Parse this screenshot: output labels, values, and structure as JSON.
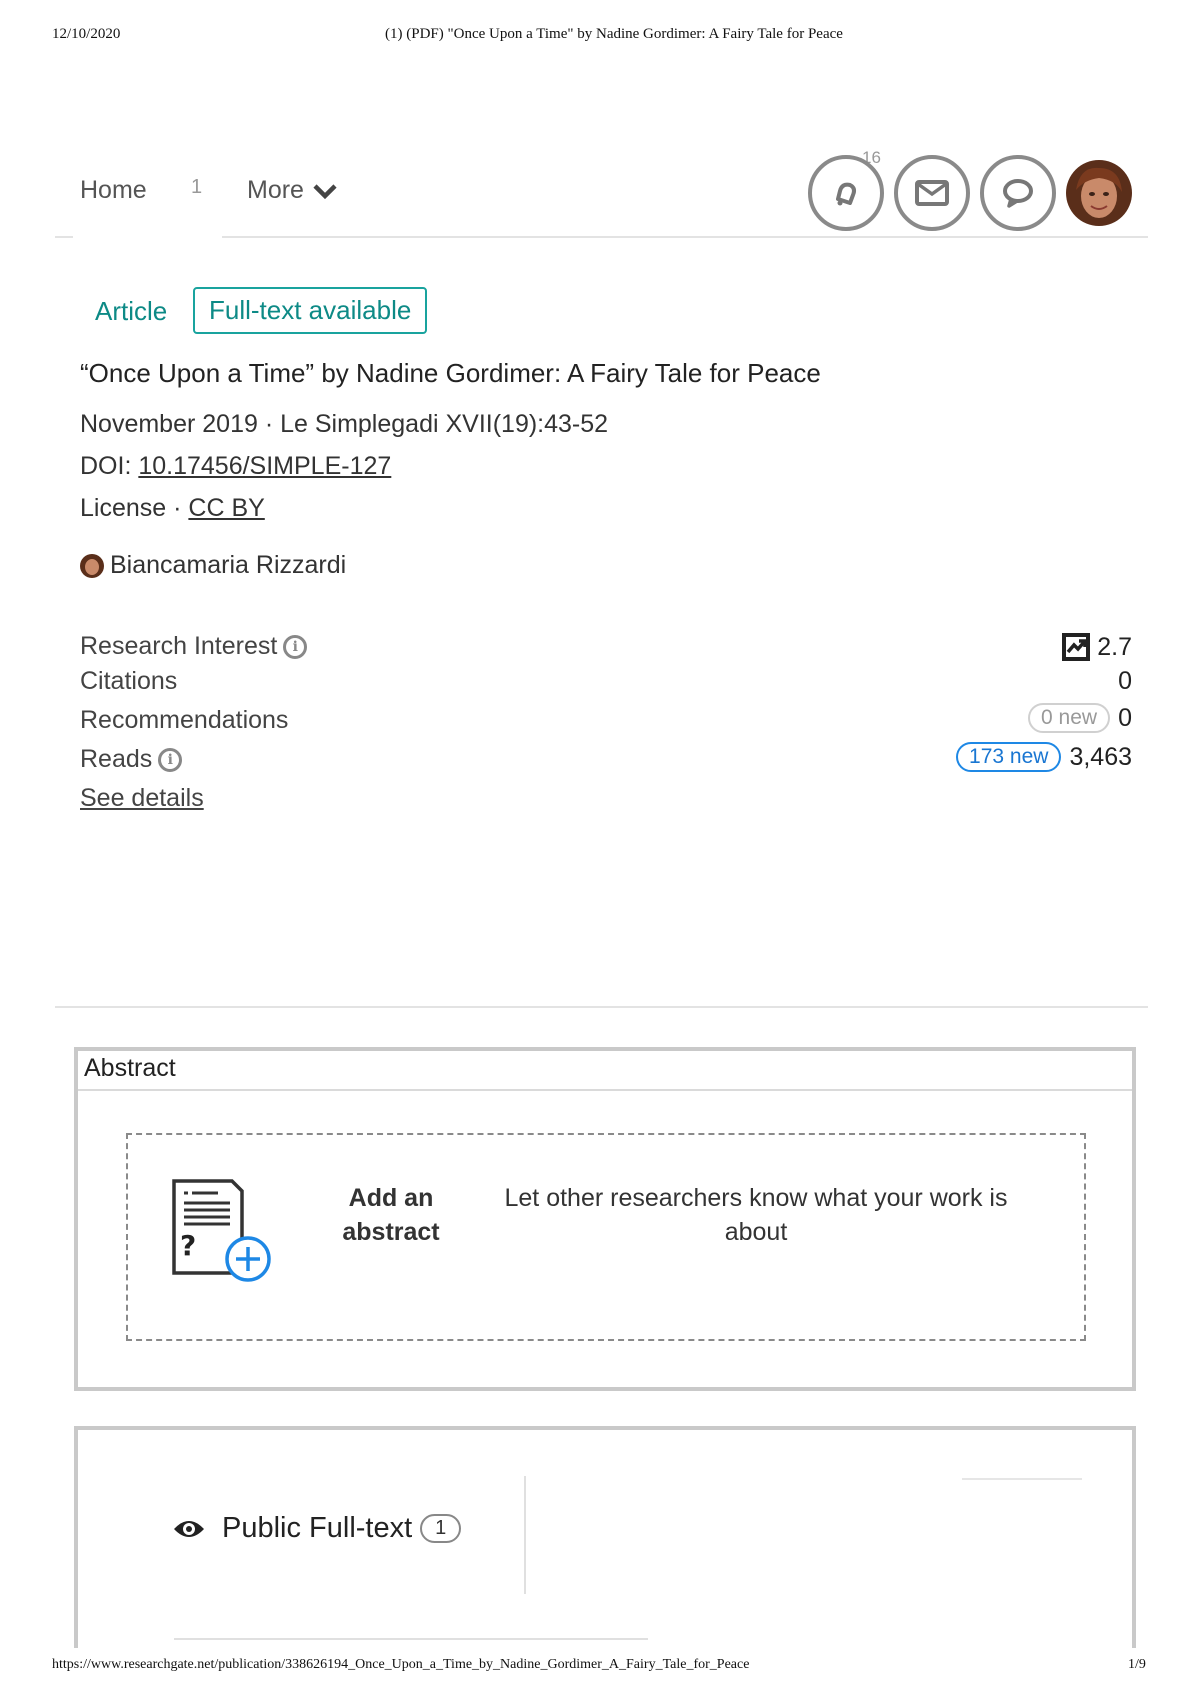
{
  "print_header": {
    "date": "12/10/2020",
    "doc_title": "(1) (PDF) \"Once Upon a Time\" by Nadine Gordimer: A Fairy Tale for Peace"
  },
  "nav": {
    "home_label": "Home",
    "home_count": "1",
    "more_label": "More",
    "notifications_count": "16"
  },
  "tags": {
    "type": "Article",
    "availability": "Full-text available"
  },
  "publication": {
    "title": "“Once Upon a Time” by Nadine Gordimer: A Fairy Tale for Peace",
    "date_journal": "November 2019 · Le Simplegadi XVII(19):43-52",
    "doi_label": "DOI: ",
    "doi": "10.17456/SIMPLE-127",
    "license_label": "License · ",
    "license": "CC BY",
    "author": "Biancamaria Rizzardi"
  },
  "stats": {
    "research_interest_label": "Research Interest",
    "research_interest_value": "2.7",
    "citations_label": "Citations",
    "citations_value": "0",
    "recommendations_label": "Recommendations",
    "recommendations_new": "0 new",
    "recommendations_value": "0",
    "reads_label": "Reads",
    "reads_new": "173 new",
    "reads_value": "3,463",
    "see_details": "See details"
  },
  "abstract": {
    "heading": "Abstract",
    "add_label": "Add an abstract",
    "hint": "Let other researchers know what your work is about"
  },
  "fulltext": {
    "label": "Public Full-text",
    "count": "1"
  },
  "print_footer": {
    "url": "https://www.researchgate.net/publication/338626194_Once_Upon_a_Time_by_Nadine_Gordimer_A_Fairy_Tale_for_Peace",
    "page": "1/9"
  },
  "colors": {
    "accent_teal": "#19a39e",
    "accent_blue": "#1e88e5"
  }
}
